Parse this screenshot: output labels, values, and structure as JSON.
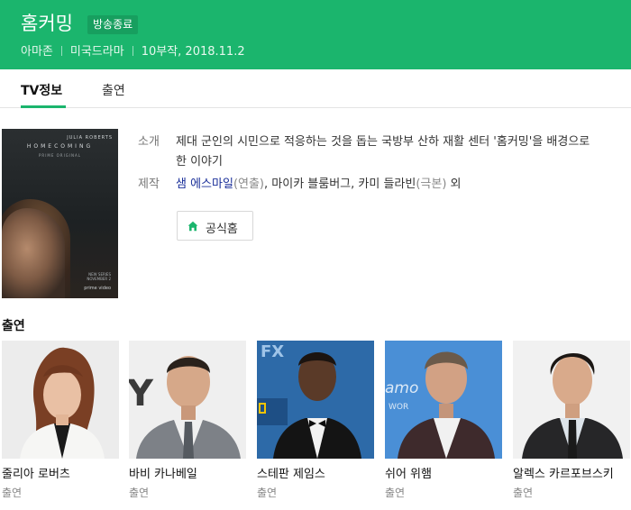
{
  "header": {
    "title": "홈커밍",
    "badge": "방송종료",
    "meta": [
      "아마존",
      "미국드라마",
      "10부작, 2018.11.2"
    ]
  },
  "tabs": [
    {
      "label": "TV정보",
      "active": true
    },
    {
      "label": "출연",
      "active": false
    }
  ],
  "poster": {
    "actor": "JULIA ROBERTS",
    "title": "HOMECOMING",
    "original": "PRIME ORIGINAL",
    "series": "NEW SERIES\nNOVEMBER 2",
    "brand": "prime video"
  },
  "info": {
    "intro_label": "소개",
    "intro_text": "제대 군인의 시민으로 적응하는 것을 돕는 국방부 산하 재활 센터 '홈커밍'을 배경으로 한 이야기",
    "production_label": "제작",
    "director_name": "샘 에스마일",
    "director_role": "(연출)",
    "writers": ", 마이카 블룸버그, 카미 들라빈",
    "writers_role": "(극본)",
    "suffix": " 외"
  },
  "home_button": {
    "label": "공식홈",
    "icon": "home-icon"
  },
  "cast": {
    "heading": "출연",
    "members": [
      {
        "name": "줄리아 로버츠",
        "role": "출연"
      },
      {
        "name": "바비 카나베일",
        "role": "출연"
      },
      {
        "name": "스테판 제임스",
        "role": "출연"
      },
      {
        "name": "쉬어 위햄",
        "role": "출연"
      },
      {
        "name": "알렉스 카르포브스키",
        "role": "출연"
      }
    ]
  },
  "colors": {
    "accent": "#1bb56d",
    "link": "#1a2f99"
  }
}
